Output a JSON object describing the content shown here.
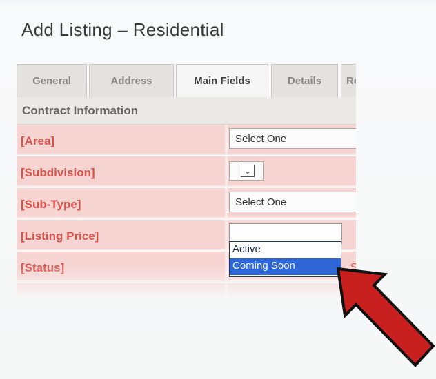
{
  "page": {
    "title": "Add Listing – Residential"
  },
  "tabs": [
    {
      "label": "General",
      "active": false
    },
    {
      "label": "Address",
      "active": false
    },
    {
      "label": "Main Fields",
      "active": true
    },
    {
      "label": "Details",
      "active": false
    },
    {
      "label": "Roo",
      "active": false
    }
  ],
  "form": {
    "section_title": "Contract Information",
    "fields": {
      "area": {
        "label": "[Area]",
        "value": "Select One"
      },
      "subdivision": {
        "label": "[Subdivision]",
        "value": ""
      },
      "subtype": {
        "label": "[Sub-Type]",
        "value": "Select One"
      },
      "listing_price": {
        "label": "[Listing Price]",
        "value": ""
      },
      "status": {
        "label": "[Status]",
        "marker": "S"
      }
    },
    "status_dropdown": {
      "options": [
        "Active",
        "Coming Soon"
      ],
      "highlighted": "Coming Soon"
    }
  },
  "annotation": {
    "arrow_color": "#c8201e",
    "arrow_outline": "#111111"
  },
  "colors": {
    "required_label": "#d9524a",
    "required_row_bg": "#f6d4d2",
    "highlight": "#2f66d6"
  }
}
